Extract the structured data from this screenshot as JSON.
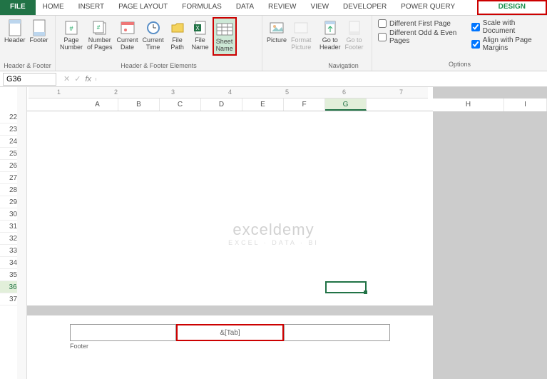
{
  "tabs": {
    "file": "FILE",
    "items": [
      "HOME",
      "INSERT",
      "PAGE LAYOUT",
      "FORMULAS",
      "DATA",
      "REVIEW",
      "VIEW",
      "DEVELOPER",
      "POWER QUERY"
    ],
    "active": "DESIGN"
  },
  "ribbon": {
    "header_footer": {
      "header": "Header",
      "footer": "Footer",
      "group": "Header & Footer"
    },
    "elements": {
      "page_number": "Page\nNumber",
      "number_of_pages": "Number\nof Pages",
      "current_date": "Current\nDate",
      "current_time": "Current\nTime",
      "file_path": "File\nPath",
      "file_name": "File\nName",
      "sheet_name": "Sheet\nName",
      "picture": "Picture",
      "format_picture": "Format\nPicture",
      "group": "Header & Footer Elements"
    },
    "navigation": {
      "goto_header": "Go to\nHeader",
      "goto_footer": "Go to\nFooter",
      "group": "Navigation"
    },
    "options": {
      "diff_first": "Different First Page",
      "diff_odd_even": "Different Odd & Even Pages",
      "scale": "Scale with Document",
      "align": "Align with Page Margins",
      "group": "Options"
    }
  },
  "namebox": "G36",
  "fx_label": "fx",
  "columns": [
    "A",
    "B",
    "C",
    "D",
    "E",
    "F",
    "G"
  ],
  "columns_right": [
    "H",
    "I"
  ],
  "rows": [
    22,
    23,
    24,
    25,
    26,
    27,
    28,
    29,
    30,
    31,
    32,
    33,
    34,
    35,
    36,
    37
  ],
  "ruler_ticks": [
    "1",
    "2",
    "3",
    "4",
    "5",
    "6",
    "7"
  ],
  "footer": {
    "code": "&[Tab]",
    "label": "Footer"
  },
  "watermark": {
    "title": "exceldemy",
    "sub": "EXCEL · DATA · BI"
  },
  "selected_cell": "G36"
}
